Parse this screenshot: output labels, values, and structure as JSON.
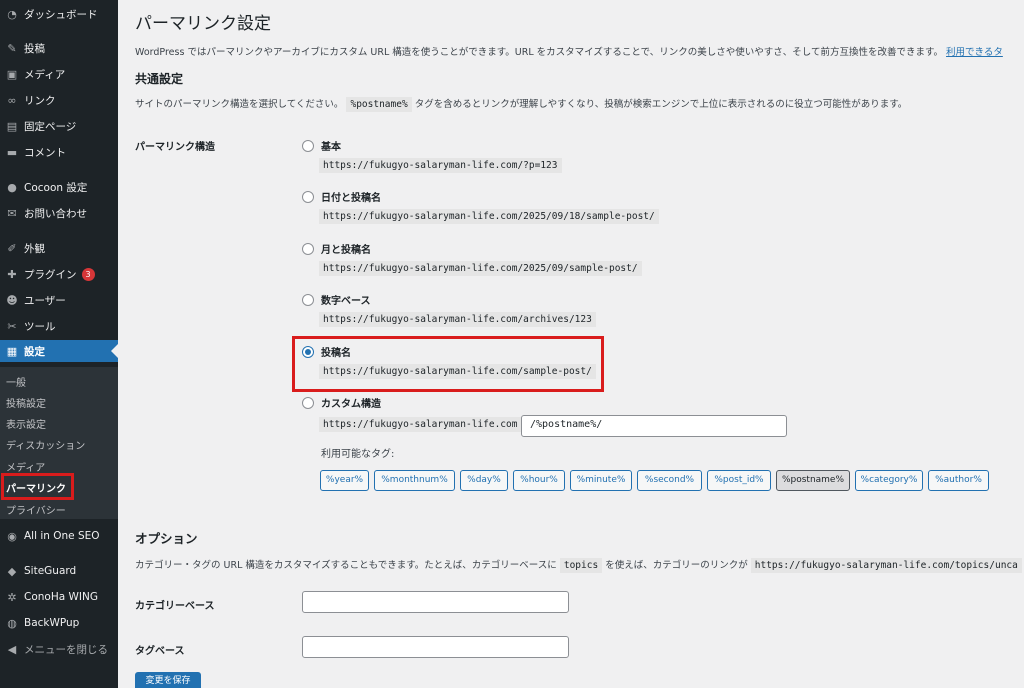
{
  "sidebar": {
    "dashboard": "ダッシュボード",
    "posts": "投稿",
    "media": "メディア",
    "links": "リンク",
    "pages": "固定ページ",
    "comments": "コメント",
    "cocoon": "Cocoon 設定",
    "contact": "お問い合わせ",
    "appearance": "外観",
    "plugins": "プラグイン",
    "plugins_badge": "3",
    "users": "ユーザー",
    "tools": "ツール",
    "settings": "設定",
    "sub": {
      "general": "一般",
      "writing": "投稿設定",
      "reading": "表示設定",
      "discussion": "ディスカッション",
      "media": "メディア",
      "permalink": "パーマリンク",
      "privacy": "プライバシー"
    },
    "aioseo": "All in One SEO",
    "siteguard": "SiteGuard",
    "conoha": "ConoHa WING",
    "backwpup": "BackWPup",
    "collapse": "メニューを閉じる"
  },
  "main": {
    "title": "パーマリンク設定",
    "intro": "WordPress ではパーマリンクやアーカイブにカスタム URL 構造を使うことができます。URL をカスタマイズすることで、リンクの美しさや使いやすさ、そして前方互換性を改善できます。",
    "intro_link": "利用できるタ",
    "common_title": "共通設定",
    "common_desc_pre": "サイトのパーマリンク構造を選択してください。",
    "common_desc_code": "%postname%",
    "common_desc_post": "タグを含めるとリンクが理解しやすくなり、投稿が検索エンジンで上位に表示されるのに役立つ可能性があります。",
    "structure_label": "パーマリンク構造",
    "options": {
      "plain": {
        "label": "基本",
        "example": "https://fukugyo-salaryman-life.com/?p=123"
      },
      "day_name": {
        "label": "日付と投稿名",
        "example": "https://fukugyo-salaryman-life.com/2025/09/18/sample-post/"
      },
      "month_name": {
        "label": "月と投稿名",
        "example": "https://fukugyo-salaryman-life.com/2025/09/sample-post/"
      },
      "numeric": {
        "label": "数字ベース",
        "example": "https://fukugyo-salaryman-life.com/archives/123"
      },
      "post_name": {
        "label": "投稿名",
        "example": "https://fukugyo-salaryman-life.com/sample-post/"
      },
      "custom": {
        "label": "カスタム構造",
        "prefix": "https://fukugyo-salaryman-life.com",
        "value": "/%postname%/"
      }
    },
    "selected_option": "post_name",
    "available_tags_label": "利用可能なタグ:",
    "tags": [
      "%year%",
      "%monthnum%",
      "%day%",
      "%hour%",
      "%minute%",
      "%second%",
      "%post_id%",
      "%postname%",
      "%category%",
      "%author%"
    ],
    "active_tag": "%postname%",
    "options_title": "オプション",
    "options_desc_pre": "カテゴリー・タグの URL 構造をカスタマイズすることもできます。たとえば、カテゴリーベースに",
    "options_desc_code": "topics",
    "options_desc_mid": "を使えば、カテゴリーのリンクが",
    "options_desc_code2": "https://fukugyo-salaryman-life.com/topics/unca",
    "category_base_label": "カテゴリーベース",
    "category_base_value": "",
    "tag_base_label": "タグベース",
    "tag_base_value": "",
    "save_label": "変更を保存"
  },
  "colors": {
    "sidebar_bg": "#1d2327",
    "accent": "#2271b1",
    "highlight_box": "#d91c1c",
    "badge": "#d63638"
  }
}
